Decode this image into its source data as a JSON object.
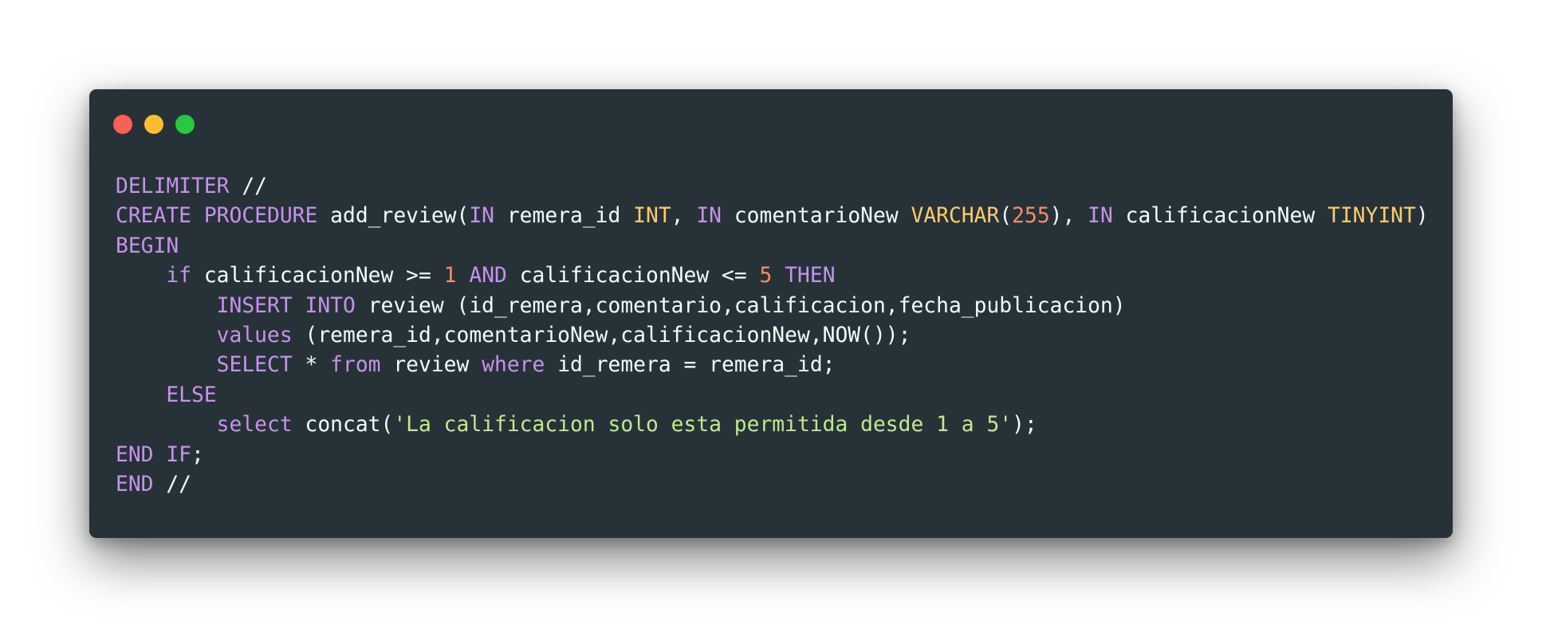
{
  "window": {
    "controls": [
      {
        "name": "close-control",
        "color": "#FF5F56"
      },
      {
        "name": "minimize-control",
        "color": "#FFBD2E"
      },
      {
        "name": "maximize-control",
        "color": "#27C93F"
      }
    ]
  },
  "colors": {
    "background": "#263238",
    "plain": "#EEFFFF",
    "keyword": "#C792EA",
    "type": "#FFCB6B",
    "number": "#F78C6C",
    "string": "#C3E88D"
  },
  "code": {
    "language": "sql",
    "lines": [
      [
        {
          "t": "keyword",
          "v": "DELIMITER"
        },
        {
          "t": "plain",
          "v": " //"
        }
      ],
      [
        {
          "t": "keyword",
          "v": "CREATE"
        },
        {
          "t": "plain",
          "v": " "
        },
        {
          "t": "keyword",
          "v": "PROCEDURE"
        },
        {
          "t": "plain",
          "v": " add_review("
        },
        {
          "t": "keyword",
          "v": "IN"
        },
        {
          "t": "plain",
          "v": " remera_id "
        },
        {
          "t": "type",
          "v": "INT"
        },
        {
          "t": "plain",
          "v": ", "
        },
        {
          "t": "keyword",
          "v": "IN"
        },
        {
          "t": "plain",
          "v": " comentarioNew "
        },
        {
          "t": "type",
          "v": "VARCHAR"
        },
        {
          "t": "plain",
          "v": "("
        },
        {
          "t": "number",
          "v": "255"
        },
        {
          "t": "plain",
          "v": "), "
        },
        {
          "t": "keyword",
          "v": "IN"
        },
        {
          "t": "plain",
          "v": " calificacionNew "
        },
        {
          "t": "type",
          "v": "TINYINT"
        },
        {
          "t": "plain",
          "v": ")"
        }
      ],
      [
        {
          "t": "keyword",
          "v": "BEGIN"
        }
      ],
      [
        {
          "t": "plain",
          "v": "    "
        },
        {
          "t": "keyword",
          "v": "if"
        },
        {
          "t": "plain",
          "v": " calificacionNew >= "
        },
        {
          "t": "number",
          "v": "1"
        },
        {
          "t": "plain",
          "v": " "
        },
        {
          "t": "keyword",
          "v": "AND"
        },
        {
          "t": "plain",
          "v": " calificacionNew <= "
        },
        {
          "t": "number",
          "v": "5"
        },
        {
          "t": "plain",
          "v": " "
        },
        {
          "t": "keyword",
          "v": "THEN"
        }
      ],
      [
        {
          "t": "plain",
          "v": "        "
        },
        {
          "t": "keyword",
          "v": "INSERT"
        },
        {
          "t": "plain",
          "v": " "
        },
        {
          "t": "keyword",
          "v": "INTO"
        },
        {
          "t": "plain",
          "v": " review (id_remera,comentario,calificacion,fecha_publicacion)"
        }
      ],
      [
        {
          "t": "plain",
          "v": "        "
        },
        {
          "t": "keyword",
          "v": "values"
        },
        {
          "t": "plain",
          "v": " (remera_id,comentarioNew,calificacionNew,NOW());"
        }
      ],
      [
        {
          "t": "plain",
          "v": "        "
        },
        {
          "t": "keyword",
          "v": "SELECT"
        },
        {
          "t": "plain",
          "v": " * "
        },
        {
          "t": "keyword",
          "v": "from"
        },
        {
          "t": "plain",
          "v": " review "
        },
        {
          "t": "keyword",
          "v": "where"
        },
        {
          "t": "plain",
          "v": " id_remera = remera_id;"
        }
      ],
      [
        {
          "t": "plain",
          "v": "    "
        },
        {
          "t": "keyword",
          "v": "ELSE"
        }
      ],
      [
        {
          "t": "plain",
          "v": "        "
        },
        {
          "t": "keyword",
          "v": "select"
        },
        {
          "t": "plain",
          "v": " concat("
        },
        {
          "t": "string",
          "v": "'La calificacion solo esta permitida desde 1 a 5'"
        },
        {
          "t": "plain",
          "v": ");"
        }
      ],
      [
        {
          "t": "keyword",
          "v": "END"
        },
        {
          "t": "plain",
          "v": " "
        },
        {
          "t": "keyword",
          "v": "IF"
        },
        {
          "t": "plain",
          "v": ";"
        }
      ],
      [
        {
          "t": "keyword",
          "v": "END"
        },
        {
          "t": "plain",
          "v": " //"
        }
      ]
    ]
  }
}
